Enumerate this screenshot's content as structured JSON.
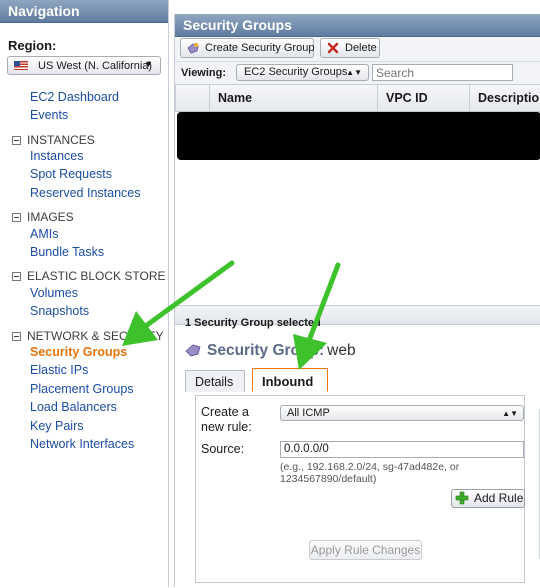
{
  "nav": {
    "title": "Navigation",
    "region_label": "Region:",
    "region_value": "US West (N. California)",
    "links": {
      "ec2_dashboard": "EC2 Dashboard",
      "events": "Events",
      "instances": "Instances",
      "spot_requests": "Spot Requests",
      "reserved_instances": "Reserved Instances",
      "amis": "AMIs",
      "bundle_tasks": "Bundle Tasks",
      "volumes": "Volumes",
      "snapshots": "Snapshots",
      "security_groups": "Security Groups",
      "elastic_ips": "Elastic IPs",
      "placement_groups": "Placement Groups",
      "load_balancers": "Load Balancers",
      "key_pairs": "Key Pairs",
      "network_interfaces": "Network Interfaces"
    },
    "sections": {
      "instances": "INSTANCES",
      "images": "IMAGES",
      "ebs": "ELASTIC BLOCK STORE",
      "network": "NETWORK & SECURITY"
    }
  },
  "main": {
    "title": "Security Groups",
    "toolbar": {
      "create_label": "Create Security Group",
      "delete_label": "Delete"
    },
    "viewing_label": "Viewing:",
    "viewing_value": "EC2 Security Groups",
    "search_placeholder": "Search",
    "columns": {
      "name": "Name",
      "vpc_id": "VPC ID",
      "description": "Description"
    }
  },
  "detail": {
    "selected_text": "1 Security Group selected",
    "heading_prefix": "Security Group:",
    "group_name": "web",
    "tabs": {
      "details": "Details",
      "inbound": "Inbound"
    },
    "create_rule_label_1": "Create a",
    "create_rule_label_2": "new rule:",
    "rule_value": "All ICMP",
    "source_label": "Source:",
    "source_value": "0.0.0.0/0",
    "hint_line_1": "(e.g., 192.168.2.0/24, sg-47ad482e, or",
    "hint_line_2": "1234567890/default)",
    "add_rule_label": "Add Rule",
    "apply_label": "Apply Rule Changes"
  },
  "colors": {
    "accent": "#e8740c",
    "header": "#6b86a8",
    "arrow": "#3ec22c",
    "link": "#1b4ea3"
  }
}
